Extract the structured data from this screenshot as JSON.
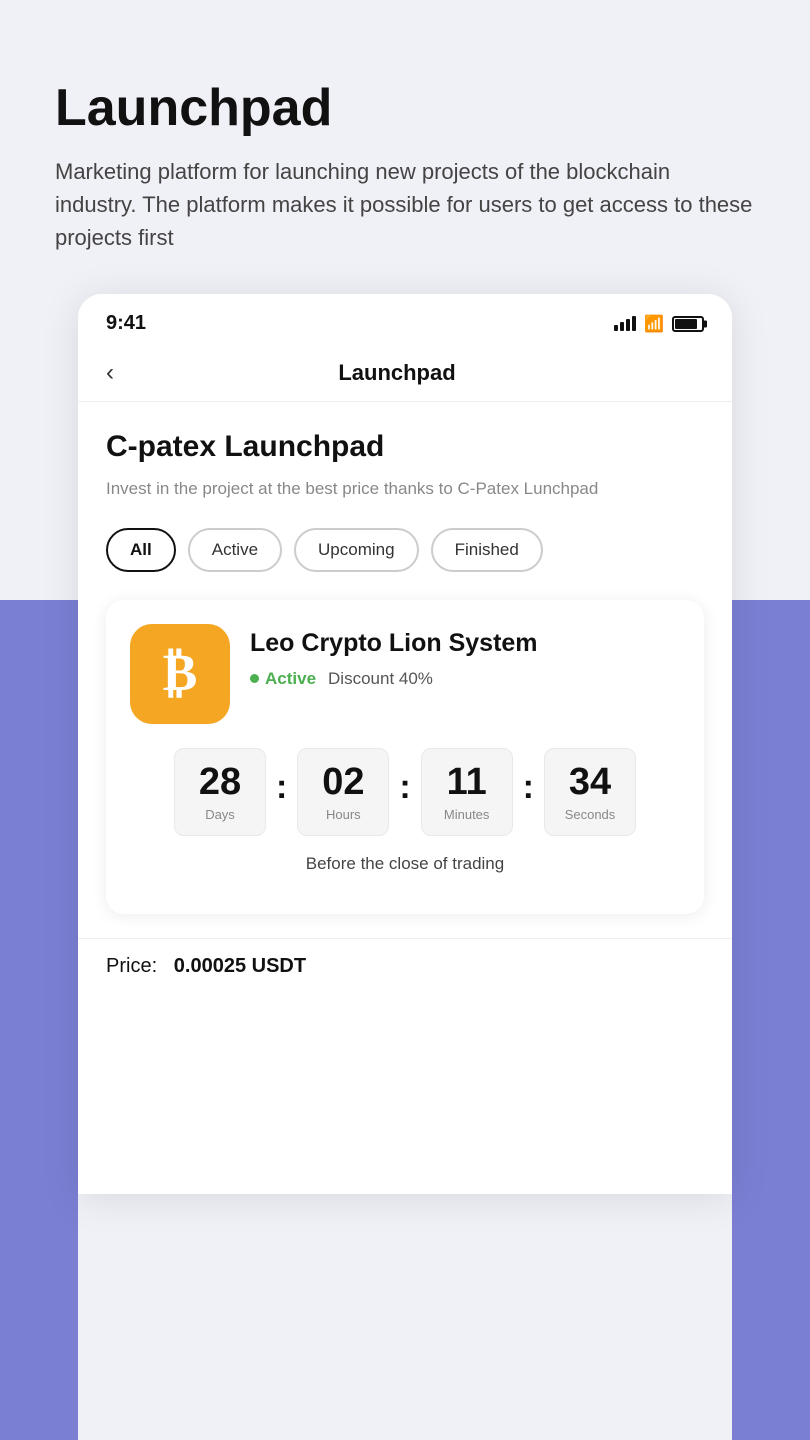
{
  "top": {
    "title": "Launchpad",
    "description": "Marketing platform for launching new projects of the blockchain industry. The platform makes it possible for users to get access to these projects first"
  },
  "statusBar": {
    "time": "9:41"
  },
  "nav": {
    "back_icon": "‹",
    "title": "Launchpad"
  },
  "content": {
    "page_title": "C-patex Launchpad",
    "page_subtitle": "Invest in the project at the best price thanks to C-Patex Lunchpad",
    "filters": [
      {
        "label": "All",
        "active": true
      },
      {
        "label": "Active",
        "active": false
      },
      {
        "label": "Upcoming",
        "active": false
      },
      {
        "label": "Finished",
        "active": false
      }
    ],
    "card": {
      "logo_symbol": "₿",
      "name": "Leo Crypto Lion System",
      "status": "Active",
      "discount": "Discount 40%",
      "countdown": {
        "days": "28",
        "days_label": "Days",
        "hours": "02",
        "hours_label": "Hours",
        "minutes": "11",
        "minutes_label": "Minutes",
        "seconds": "34",
        "seconds_label": "Seconds"
      },
      "countdown_caption": "Before the close of trading",
      "price_label": "Price:",
      "price_value": "0.00025 USDT"
    }
  }
}
